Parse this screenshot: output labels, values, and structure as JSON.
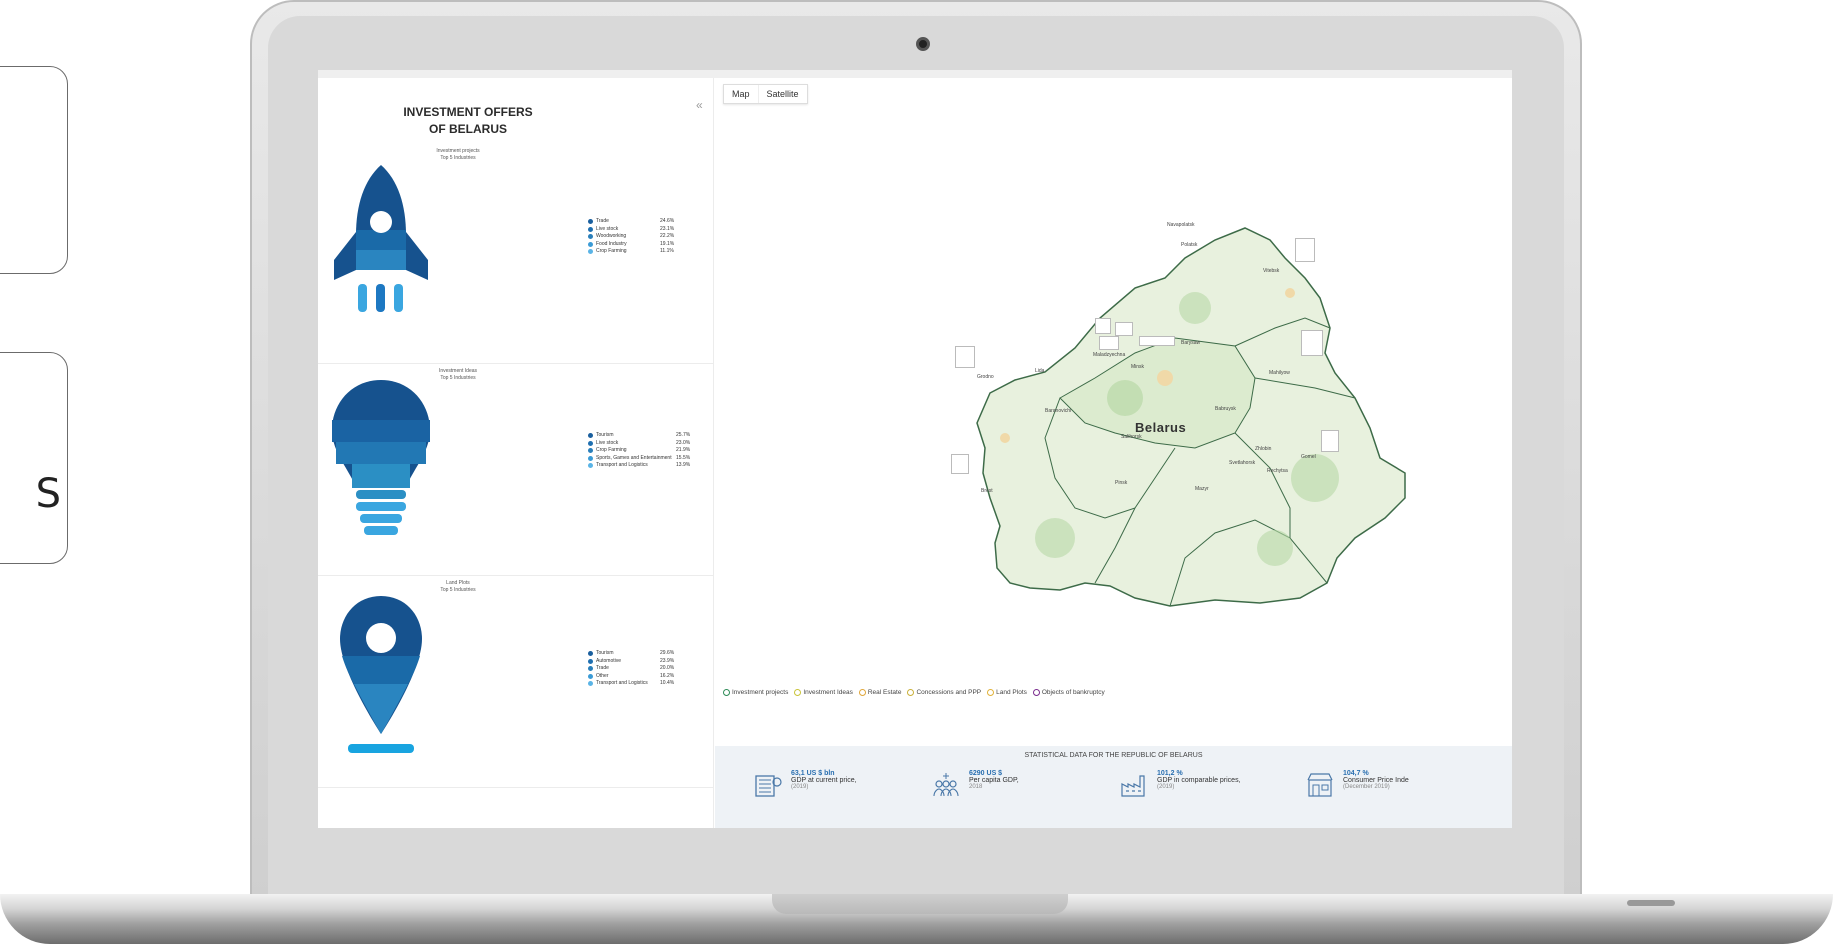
{
  "side_cards": {
    "glyph": "S"
  },
  "left_panel": {
    "title": "INVESTMENT OFFERS\nOF BELARUS",
    "collapse": "«",
    "sections": [
      {
        "title": "Investment projects\nTop 5 Industries",
        "icon": "rocket-icon",
        "items": [
          {
            "label": "Trade",
            "value": "24.6%",
            "color": "#1a5f9e"
          },
          {
            "label": "Live stock",
            "value": "23.1%",
            "color": "#1f6fb0"
          },
          {
            "label": "Woodworking",
            "value": "22.2%",
            "color": "#2a7fba"
          },
          {
            "label": "Food Industry",
            "value": "19.1%",
            "color": "#3b9bd6"
          },
          {
            "label": "Crop Farming",
            "value": "11.1%",
            "color": "#5ab4e6"
          }
        ]
      },
      {
        "title": "Investment Ideas\nTop 5 Industries",
        "icon": "lightbulb-icon",
        "items": [
          {
            "label": "Tourism",
            "value": "25.7%",
            "color": "#1a5f9e"
          },
          {
            "label": "Live stock",
            "value": "23.0%",
            "color": "#1f6fb0"
          },
          {
            "label": "Crop Farming",
            "value": "21.9%",
            "color": "#2a7fba"
          },
          {
            "label": "Sports, Games and Entertainment",
            "value": "15.5%",
            "color": "#3b9bd6"
          },
          {
            "label": "Transport and Logistics",
            "value": "13.9%",
            "color": "#5ab4e6"
          }
        ]
      },
      {
        "title": "Land Plots\nTop 5 Industries",
        "icon": "location-pin-icon",
        "items": [
          {
            "label": "Tourism",
            "value": "29.6%",
            "color": "#1a5f9e"
          },
          {
            "label": "Automotive",
            "value": "23.9%",
            "color": "#1f6fb0"
          },
          {
            "label": "Trade",
            "value": "20.0%",
            "color": "#2a7fba"
          },
          {
            "label": "Other",
            "value": "16.2%",
            "color": "#3b9bd6"
          },
          {
            "label": "Transport and Logistics",
            "value": "10.4%",
            "color": "#5ab4e6"
          }
        ]
      }
    ]
  },
  "map": {
    "tabs": [
      "Map",
      "Satellite"
    ],
    "country_label": "Belarus",
    "cities": [
      "Navapolatsk",
      "Polatsk",
      "Vitebsk",
      "Grodno",
      "Minsk",
      "Barysaw",
      "Mahilyow",
      "Babruysk",
      "Baranovichi",
      "Salihorsk",
      "Pinsk",
      "Brest",
      "Mazyr",
      "Gomel",
      "Zhlobin",
      "Svetlahorsk",
      "Rechytsa",
      "Lida",
      "Maladzyechna"
    ],
    "legend": [
      {
        "label": "Investment projects",
        "color": "#2e8b57"
      },
      {
        "label": "Investment Ideas",
        "color": "#c9c43a"
      },
      {
        "label": "Real Estate",
        "color": "#e0a63a"
      },
      {
        "label": "Concessions and PPP",
        "color": "#c9b03a"
      },
      {
        "label": "Land Plots",
        "color": "#e0b23a"
      },
      {
        "label": "Objects of bankruptcy",
        "color": "#7b2d8e"
      }
    ]
  },
  "stats": {
    "title": "STATISTICAL DATA FOR THE REPUBLIC OF BELARUS",
    "items": [
      {
        "value": "63,1 US $ bln",
        "desc": "GDP at current price,",
        "year": "(2019)",
        "icon": "building-chart-icon"
      },
      {
        "value": "6290 US $",
        "desc": "Per capita GDP,",
        "year": "2018",
        "icon": "people-icon"
      },
      {
        "value": "101,2 %",
        "desc": "GDP in comparable prices,",
        "year": "(2019)",
        "icon": "factory-icon"
      },
      {
        "value": "104,7 %",
        "desc": "Consumer Price Inde",
        "year": "(December 2019)",
        "icon": "shop-icon"
      }
    ]
  }
}
